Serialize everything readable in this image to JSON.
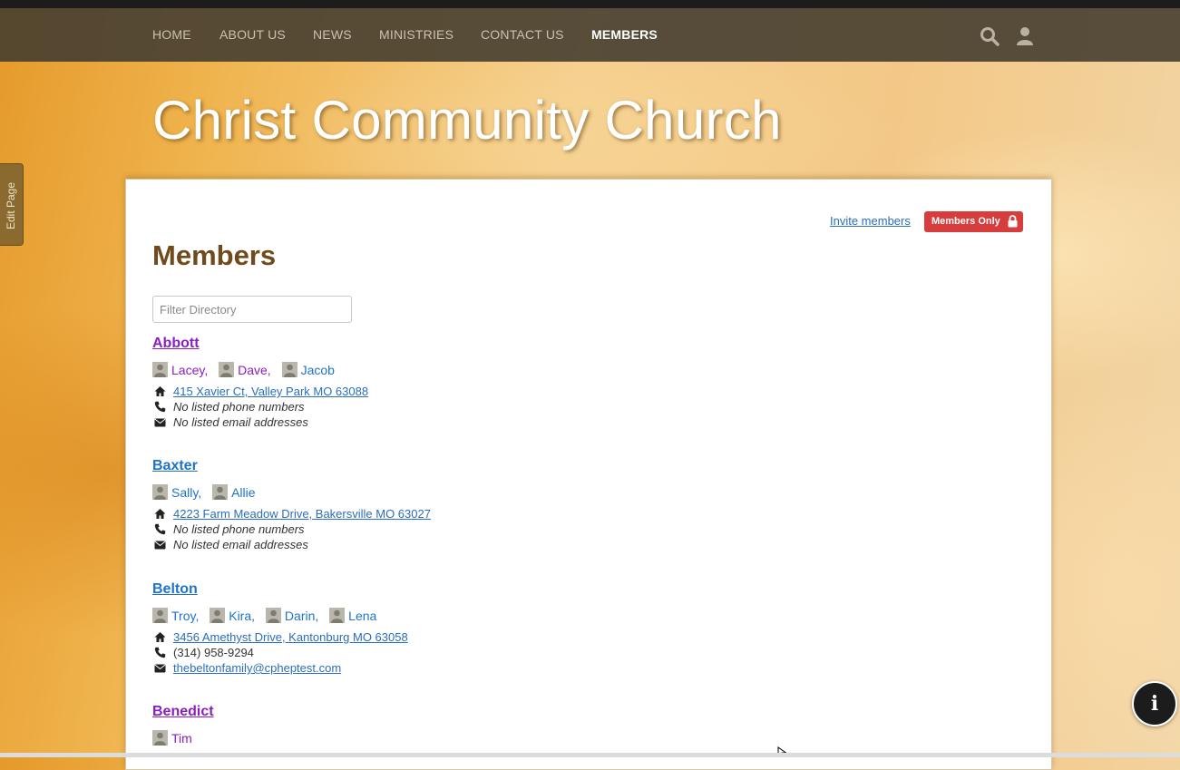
{
  "nav": {
    "items": [
      {
        "label": "HOME",
        "active": false
      },
      {
        "label": "ABOUT US",
        "active": false
      },
      {
        "label": "NEWS",
        "active": false
      },
      {
        "label": "MINISTRIES",
        "active": false
      },
      {
        "label": "CONTACT US",
        "active": false
      },
      {
        "label": "MEMBERS",
        "active": true
      }
    ],
    "icons": [
      "search-icon",
      "user-icon"
    ]
  },
  "site": {
    "title": "Christ Community Church"
  },
  "edit_tab": {
    "label": "Edit Page"
  },
  "toolbar": {
    "invite_label": "Invite members",
    "badge_label": "Members Only",
    "badge_icon": "lock-icon"
  },
  "page": {
    "title": "Members"
  },
  "filter": {
    "placeholder": "Filter Directory",
    "value": ""
  },
  "families": [
    {
      "name": "Abbott",
      "members": [
        "Lacey,",
        "Dave,",
        "Jacob"
      ],
      "address": "415 Xavier Ct, Valley Park MO 63088",
      "phone": "No listed phone numbers",
      "email": "No listed email addresses"
    },
    {
      "name": "Baxter",
      "members": [
        "Sally,",
        "Allie"
      ],
      "address": "4223 Farm Meadow Drive, Bakersville MO 63027",
      "phone": "No listed phone numbers",
      "email": "No listed email addresses"
    },
    {
      "name": "Belton",
      "members": [
        "Troy,",
        "Kira,",
        "Darin,",
        "Lena"
      ],
      "address": "3456 Amethyst Drive, Kantonburg MO 63058",
      "phone": "(314) 958-9294",
      "email": "thebeltonfamily@cpheptest.com"
    },
    {
      "name": "Benedict",
      "members": [
        "Tim"
      ]
    }
  ],
  "colors": {
    "visited_link": "#8a1ec0",
    "link": "#1f73c9",
    "badge": "#d73d3d",
    "heading": "#6e4a1c",
    "navbar": "#463e30"
  },
  "info_button": {
    "label": "i"
  }
}
